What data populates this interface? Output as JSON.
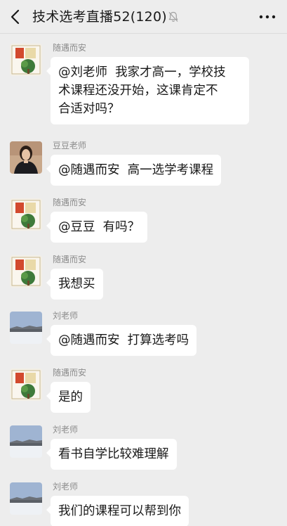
{
  "header": {
    "title": "技术选考直播52(120)",
    "back_icon": "back-chevron-icon",
    "mute_icon": "bell-muted-icon",
    "more_icon": "more-dots-icon"
  },
  "messages": [
    {
      "sender": "随遇而安",
      "avatar": "book-cover-avatar",
      "text": "@刘老师  我家才高一，学校技\n术课程还没开始，这课肯定不\n合适对吗？"
    },
    {
      "sender": "豆豆老师",
      "avatar": "teacher-photo-avatar",
      "text": "@随遇而安  高一选学考课程"
    },
    {
      "sender": "随遇而安",
      "avatar": "book-cover-avatar",
      "text": "@豆豆  有吗？"
    },
    {
      "sender": "随遇而安",
      "avatar": "book-cover-avatar",
      "text": "我想买"
    },
    {
      "sender": "刘老师",
      "avatar": "snow-landscape-avatar",
      "text": "@随遇而安  打算选考吗"
    },
    {
      "sender": "随遇而安",
      "avatar": "book-cover-avatar",
      "text": "是的"
    },
    {
      "sender": "刘老师",
      "avatar": "snow-landscape-avatar",
      "text": "看书自学比较难理解"
    },
    {
      "sender": "刘老师",
      "avatar": "snow-landscape-avatar",
      "text": "我们的课程可以帮到你"
    }
  ]
}
